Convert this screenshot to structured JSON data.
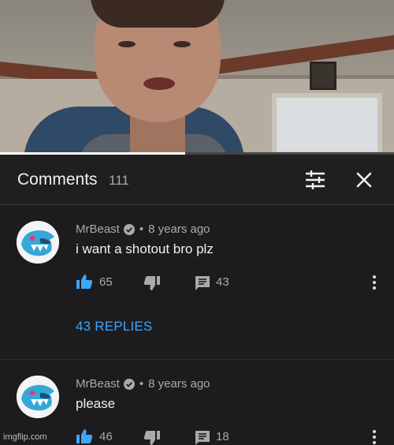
{
  "header": {
    "title": "Comments",
    "count": "111",
    "icons": {
      "sort": "sort-filter-icon",
      "close": "close-icon"
    }
  },
  "video": {
    "progress_fraction": 0.47
  },
  "comments": [
    {
      "author": "MrBeast",
      "verified": true,
      "separator": "•",
      "time": "8 years ago",
      "text": "i want a shotout bro plz",
      "likes": "65",
      "replies_count": "43",
      "replies_label": "43 REPLIES"
    },
    {
      "author": "MrBeast",
      "verified": true,
      "separator": "•",
      "time": "8 years ago",
      "text": "please",
      "likes": "46",
      "replies_count": "18"
    }
  ],
  "colors": {
    "accent": "#3ea6ff",
    "background": "#1c1c1e",
    "muted": "#aaaaaa"
  },
  "watermark": "imgflip.com"
}
